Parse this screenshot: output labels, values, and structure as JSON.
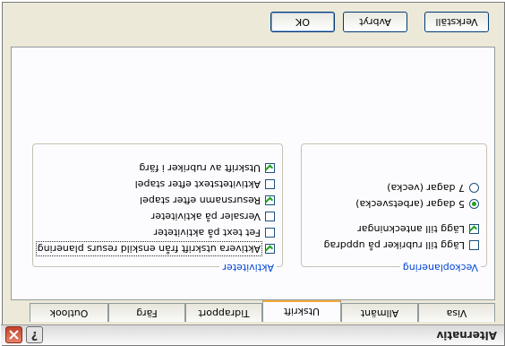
{
  "window": {
    "title": "Alternativ",
    "help_label": "?"
  },
  "tabs": [
    {
      "label": "Visa"
    },
    {
      "label": "Allmänt"
    },
    {
      "label": "Utskrift"
    },
    {
      "label": "Tidrapport"
    },
    {
      "label": "Färg"
    },
    {
      "label": "Outlook"
    }
  ],
  "active_tab": "Utskrift",
  "aktiviteter": {
    "title": "Aktiviteter",
    "options": [
      {
        "label": "Aktivera utskrift från enskild resurs planering",
        "checked": true
      },
      {
        "label": "Fet text på aktiviteter",
        "checked": false
      },
      {
        "label": "Versaler på aktiviteter",
        "checked": false
      },
      {
        "label": "Resursnamn efter stapel",
        "checked": true
      },
      {
        "label": "Aktivitetstext efter stapel",
        "checked": false
      },
      {
        "label": "Utskrift av rubriker i färg",
        "checked": true
      }
    ]
  },
  "veckoplanering": {
    "title": "Veckoplanering",
    "checkboxes": [
      {
        "label": "Lägg till rubriker på uppdrag",
        "checked": false
      },
      {
        "label": "Lägg till anteckningar",
        "checked": true
      }
    ],
    "radios": [
      {
        "label": "5 dagar (arbetsvecka)",
        "checked": true
      },
      {
        "label": "7 dagar (vecka)",
        "checked": false
      }
    ]
  },
  "buttons": {
    "verkstall": "Verkställ",
    "avbryt": "Avbryt",
    "ok": "OK"
  },
  "colors": {
    "accent_tab": "#f7a93c",
    "group_title": "#0046d5",
    "check": "#21a121",
    "close": "#c3412a"
  }
}
